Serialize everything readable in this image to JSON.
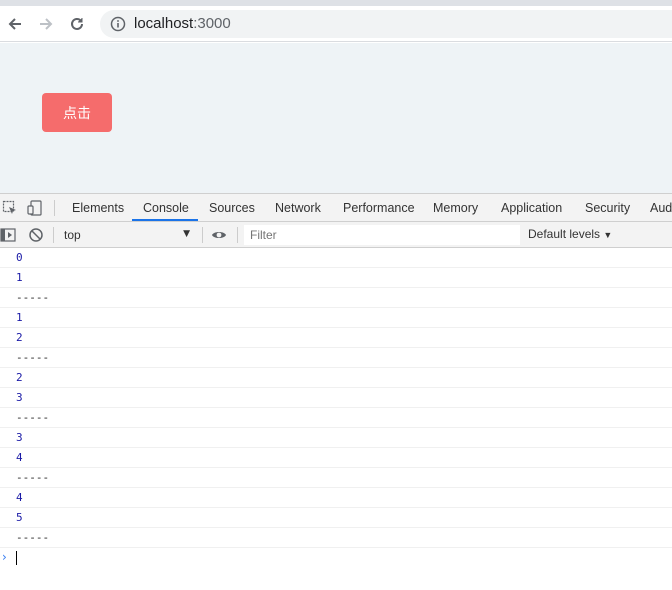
{
  "browser": {
    "url_host": "localhost",
    "url_port": ":3000"
  },
  "page": {
    "button_label": "点击",
    "button_color": "#f56c6c"
  },
  "devtools": {
    "tabs": [
      "Elements",
      "Console",
      "Sources",
      "Network",
      "Performance",
      "Memory",
      "Application",
      "Security",
      "Aud"
    ],
    "active_tab": "Console",
    "context": "top",
    "filter_placeholder": "Filter",
    "levels_label": "Default levels",
    "accent": "#1a73e8"
  },
  "console": {
    "lines": [
      {
        "text": "0",
        "kind": "num"
      },
      {
        "text": "1",
        "kind": "num"
      },
      {
        "text": "-----",
        "kind": "str"
      },
      {
        "text": "1",
        "kind": "num"
      },
      {
        "text": "2",
        "kind": "num"
      },
      {
        "text": "-----",
        "kind": "str"
      },
      {
        "text": "2",
        "kind": "num"
      },
      {
        "text": "3",
        "kind": "num"
      },
      {
        "text": "-----",
        "kind": "str"
      },
      {
        "text": "3",
        "kind": "num"
      },
      {
        "text": "4",
        "kind": "num"
      },
      {
        "text": "-----",
        "kind": "str"
      },
      {
        "text": "4",
        "kind": "num"
      },
      {
        "text": "5",
        "kind": "num"
      },
      {
        "text": "-----",
        "kind": "str"
      }
    ]
  }
}
